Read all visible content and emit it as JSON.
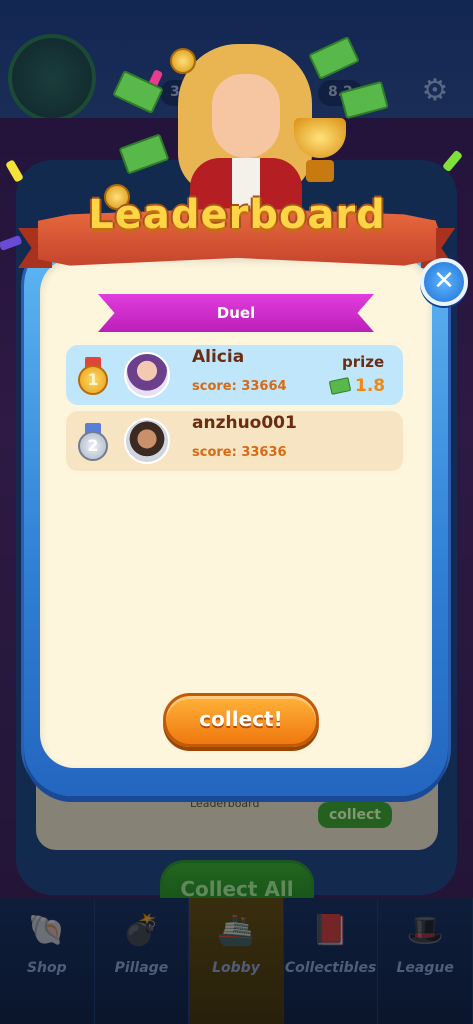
{
  "background": {
    "score_left": "32",
    "score_right": "8.2"
  },
  "modal": {
    "title": "Leaderboard",
    "close_symbol": "✕",
    "tab_label": "Duel",
    "prize_label": "prize",
    "collect_label": "collect!"
  },
  "players": [
    {
      "rank": "1",
      "name": "Alicia",
      "score": "score: 33664",
      "prize": "1.8"
    },
    {
      "rank": "2",
      "name": "anzhuo001",
      "score": "score: 33636"
    }
  ],
  "underlay": {
    "leaderboard_label": "Leaderboard",
    "collect_label": "collect",
    "collect_all_label": "Collect All"
  },
  "bottom_nav": {
    "items": [
      {
        "label": "Shop",
        "icon": "shell-icon"
      },
      {
        "label": "Pillage",
        "icon": "cannon-icon"
      },
      {
        "label": "Lobby",
        "icon": "ship-icon"
      },
      {
        "label": "Collectibles",
        "icon": "book-icon"
      },
      {
        "label": "League",
        "icon": "pirate-hat-icon"
      }
    ]
  },
  "colors": {
    "modal_frame": "#2f7fd4",
    "modal_panel": "#fdf5dc",
    "tab": "#e23dde",
    "row_first": "#bfe6fb",
    "row_second": "#f7e4c2",
    "collect_button": "#f59220"
  }
}
